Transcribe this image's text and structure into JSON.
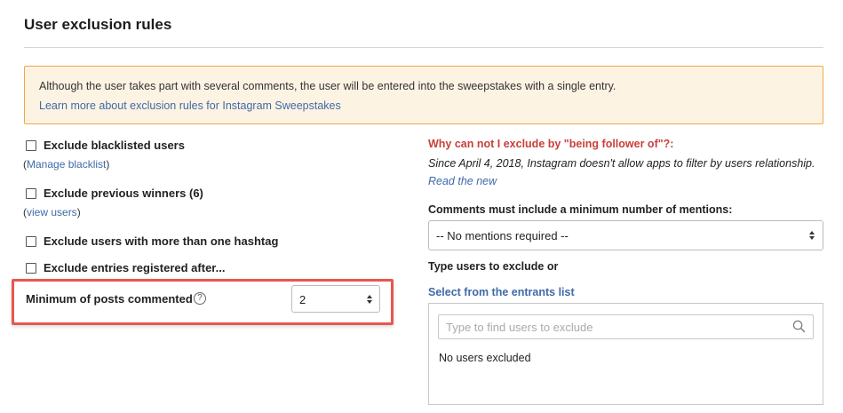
{
  "section": {
    "title": "User exclusion rules"
  },
  "notice": {
    "text": "Although the user takes part with several comments, the user will be entered into the sweepstakes with a single entry.",
    "link": "Learn more about exclusion rules for Instagram Sweepstakes"
  },
  "left": {
    "blacklist": {
      "label": "Exclude blacklisted users",
      "checked": false,
      "sub_prefix": "(",
      "sub_link": "Manage blacklist",
      "sub_suffix": ")"
    },
    "winners": {
      "label": "Exclude previous winners (6)",
      "checked": false,
      "sub_prefix": "(",
      "sub_link": "view users",
      "sub_suffix": ")"
    },
    "hashtag": {
      "label": "Exclude users with more than one hashtag",
      "checked": false
    },
    "after": {
      "label": "Exclude entries registered after...",
      "checked": false
    },
    "min_posts": {
      "label": "Minimum of posts commented",
      "help": "?",
      "value": "2"
    }
  },
  "right": {
    "why_title": "Why can not I exclude by \"being follower of\"?:",
    "why_text": "Since April 4, 2018, Instagram doesn't allow apps to filter by users relationship.",
    "why_link": "Read the new",
    "mentions_label": "Comments must include a minimum number of mentions:",
    "mentions_value": "-- No mentions required --",
    "type_label": "Type users to exclude or",
    "select_link": "Select from the entrants list",
    "search_placeholder": "Type to find users to exclude",
    "search_value": "",
    "empty_text": "No users excluded"
  },
  "colors": {
    "notice_bg": "#fdf3e3",
    "notice_border": "#f0a64a",
    "link": "#3f6aa8",
    "warning": "#c9403b",
    "highlight": "#e8574f"
  },
  "icons": {
    "help": "help-circle-icon",
    "search": "search-icon",
    "select_arrows": "updown-arrows-icon"
  }
}
